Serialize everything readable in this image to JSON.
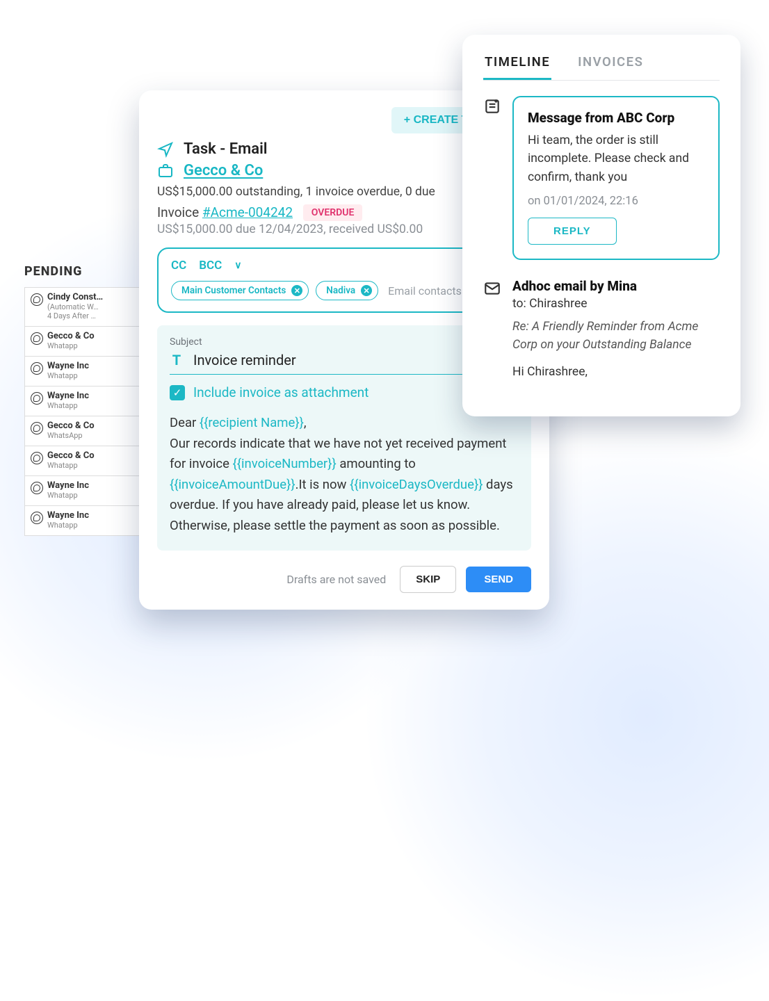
{
  "pending": {
    "title": "PENDING",
    "items": [
      {
        "name": "Cindy Const…",
        "sub1": "(Automatic W…",
        "sub2": "4 Days After …"
      },
      {
        "name": "Gecco & Co",
        "sub1": "Whatapp"
      },
      {
        "name": "Wayne Inc",
        "sub1": "Whatapp"
      },
      {
        "name": "Wayne Inc",
        "sub1": "Whatapp"
      },
      {
        "name": "Gecco & Co",
        "sub1": "WhatsApp"
      },
      {
        "name": "Gecco & Co",
        "sub1": "Whatapp"
      },
      {
        "name": "Wayne Inc",
        "sub1": "Whatapp"
      },
      {
        "name": "Wayne Inc",
        "sub1": "Whatapp"
      }
    ]
  },
  "task": {
    "create_label": "+ CREATE TASK",
    "type": "Task - Email",
    "company": "Gecco & Co",
    "summary": "US$15,000.00 outstanding, 1 invoice overdue, 0 due",
    "invoice_label": "Invoice ",
    "invoice_ref": "#Acme-004242",
    "overdue_badge": "OVERDUE",
    "due_line": "US$15,000.00 due 12/04/2023, received US$0.00",
    "contacts": {
      "cc": "CC",
      "bcc": "BCC",
      "chips": [
        "Main Customer Contacts",
        "Nadiva"
      ],
      "placeholder": "Email contacts"
    },
    "compose": {
      "subject_label": "Subject",
      "subject": "Invoice reminder",
      "include_label": "Include invoice as attachment",
      "body_pre": "Dear ",
      "var_recipient": "{{recipient Name}}",
      "body_1": ",",
      "body_2a": "Our records indicate that we have not yet received payment for invoice ",
      "var_invnum": "{{invoiceNumber}}",
      "body_2b": " amounting to ",
      "var_amount": "{{invoiceAmountDue}}",
      "body_2c": ".It is now ",
      "var_days": "{{invoiceDaysOverdue}}",
      "body_3": " days overdue. If you have already paid, please let us know. Otherwise, please settle the payment as soon as possible."
    },
    "footer": {
      "drafts": "Drafts are not saved",
      "skip": "SKIP",
      "send": "SEND"
    }
  },
  "timeline": {
    "tabs": {
      "timeline": "TIMELINE",
      "invoices": "INVOICES"
    },
    "message": {
      "title": "Message from ABC Corp",
      "body": "Hi team, the order is still incomplete. Please check and confirm, thank you",
      "meta": "on 01/01/2024, 22:16",
      "reply": "REPLY"
    },
    "adhoc": {
      "title": "Adhoc email by Mina",
      "to": "to: Chirashree",
      "subject": "Re: A Friendly Reminder from Acme Corp on your Outstanding Balance",
      "body": "Hi Chirashree,"
    }
  }
}
